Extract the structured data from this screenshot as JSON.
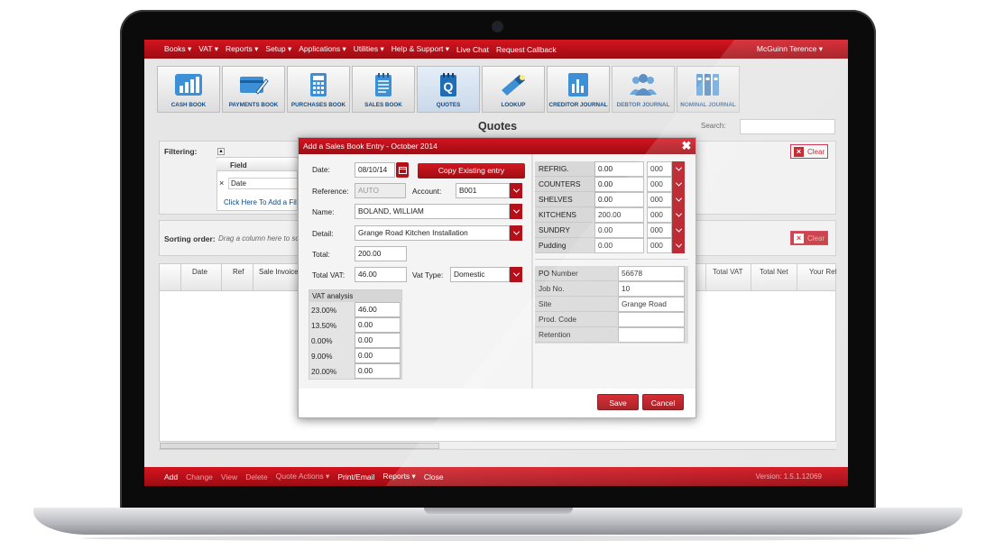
{
  "menu": {
    "items": [
      "Books ▾",
      "VAT ▾",
      "Reports ▾",
      "Setup ▾",
      "Applications ▾",
      "Utilities ▾",
      "Help & Support ▾",
      "Live Chat",
      "Request Callback"
    ],
    "user": "McGuinn Terence ▾"
  },
  "toolbar": [
    {
      "label": "CASH BOOK",
      "icon": "bar-chart-icon"
    },
    {
      "label": "PAYMENTS BOOK",
      "icon": "card-pen-icon"
    },
    {
      "label": "PURCHASES BOOK",
      "icon": "calculator-icon"
    },
    {
      "label": "SALES BOOK",
      "icon": "notebook-icon"
    },
    {
      "label": "QUOTES",
      "icon": "quotes-notepad-icon"
    },
    {
      "label": "LOOKUP",
      "icon": "flashlight-icon"
    },
    {
      "label": "CREDITOR JOURNAL",
      "icon": "report-chart-icon"
    },
    {
      "label": "DEBTOR JOURNAL",
      "icon": "people-icon"
    },
    {
      "label": "NOMINAL JOURNAL",
      "icon": "binders-icon"
    }
  ],
  "page": {
    "title": "Quotes",
    "search_label": "Search:"
  },
  "filtering": {
    "label": "Filtering:",
    "field_header": "Field",
    "row_value": "Date",
    "add_link": "Click Here To Add a Fil",
    "clear": "Clear"
  },
  "sorting": {
    "label": "Sorting order:",
    "hint": "Drag a column here to so",
    "clear": "Clear"
  },
  "grid": {
    "columns": [
      "Date",
      "Ref",
      "Sale Invoice",
      "Total VAT",
      "Total Net",
      "Your Ref"
    ]
  },
  "bottom": {
    "items": [
      "Add",
      "Change",
      "View",
      "Delete",
      "Quote Actions ▾",
      "Print/Email",
      "Reports ▾",
      "Close"
    ],
    "version": "Version: 1.5.1.12069"
  },
  "dialog": {
    "title": "Add a Sales Book Entry - October 2014",
    "date_label": "Date:",
    "date_value": "08/10/14",
    "copy_button": "Copy Existing entry",
    "reference_label": "Reference:",
    "reference_value": "AUTO",
    "account_label": "Account:",
    "account_value": "B001",
    "name_label": "Name:",
    "name_value": "BOLAND, WILLIAM",
    "detail_label": "Detail:",
    "detail_value": "Grange Road Kitchen Installation",
    "total_label": "Total:",
    "total_value": "200.00",
    "totalvat_label": "Total VAT:",
    "totalvat_value": "46.00",
    "vattype_label": "Vat Type:",
    "vattype_value": "Domestic",
    "vat_analysis": {
      "header": "VAT analysis",
      "rows": [
        {
          "rate": "23.00%",
          "value": "46.00"
        },
        {
          "rate": "13.50%",
          "value": "0.00"
        },
        {
          "rate": "0.00%",
          "value": "0.00"
        },
        {
          "rate": "9.00%",
          "value": "0.00"
        },
        {
          "rate": "20.00%",
          "value": "0.00"
        }
      ]
    },
    "categories": [
      {
        "name": "REFRIG.",
        "value": "0.00",
        "code": "000"
      },
      {
        "name": "COUNTERS",
        "value": "0.00",
        "code": "000"
      },
      {
        "name": "SHELVES",
        "value": "0.00",
        "code": "000"
      },
      {
        "name": "KITCHENS",
        "value": "200.00",
        "code": "000"
      },
      {
        "name": "SUNDRY",
        "value": "0.00",
        "code": "000"
      },
      {
        "name": "Pudding",
        "value": "0.00",
        "code": "000"
      }
    ],
    "extra": [
      {
        "label": "PO Number",
        "value": "56678"
      },
      {
        "label": "Job No.",
        "value": "10"
      },
      {
        "label": "Site",
        "value": "Grange Road"
      },
      {
        "label": "Prod. Code",
        "value": ""
      },
      {
        "label": "Retention",
        "value": ""
      }
    ],
    "save": "Save",
    "cancel": "Cancel"
  },
  "colors": {
    "brand_red": "#c0141c",
    "dark_red": "#9d0c13",
    "link_blue": "#114a86"
  }
}
